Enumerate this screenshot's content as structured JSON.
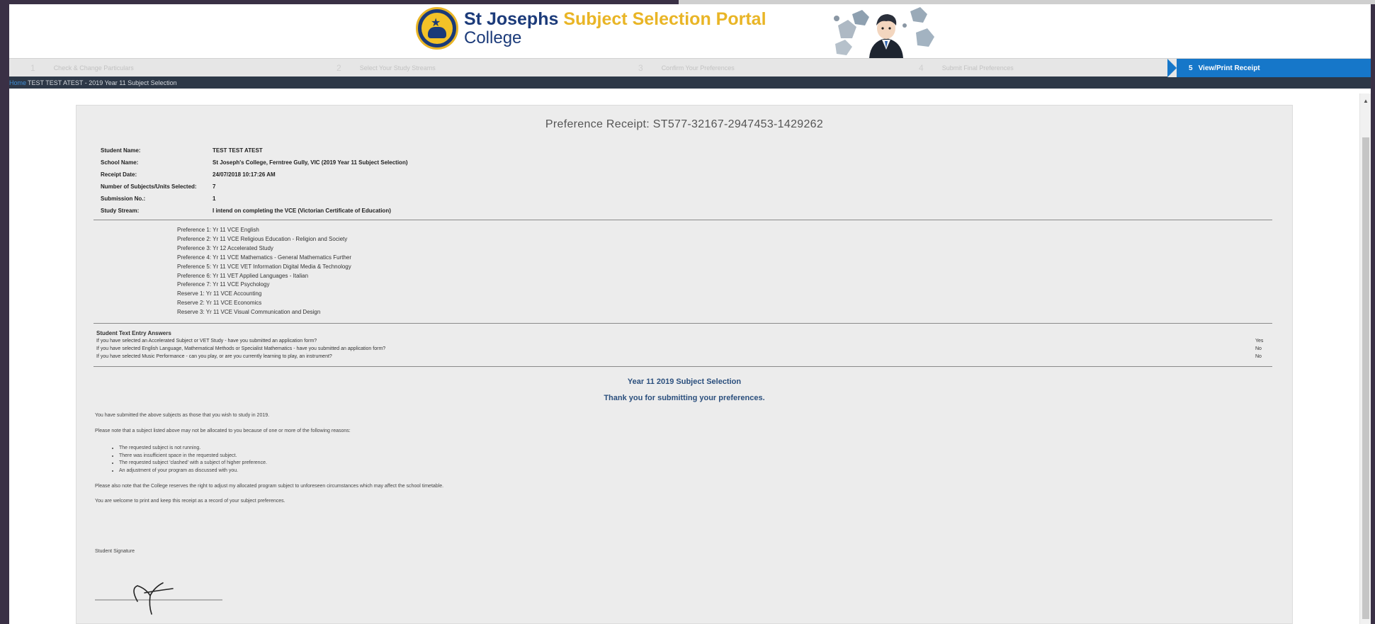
{
  "header": {
    "brand_name": "St Josephs",
    "brand_portal": "Subject Selection Portal",
    "brand_sub": "College"
  },
  "steps": [
    {
      "num": "1",
      "label": "Check & Change Particulars"
    },
    {
      "num": "2",
      "label": "Select Your Study Streams"
    },
    {
      "num": "3",
      "label": "Confirm Your Preferences"
    },
    {
      "num": "4",
      "label": "Submit Final Preferences"
    }
  ],
  "active_step": {
    "num": "5",
    "label": "View/Print Receipt"
  },
  "breadcrumb": {
    "home": "Home",
    "path": "TEST TEST ATEST - 2019 Year 11 Subject Selection"
  },
  "receipt": {
    "title": "Preference Receipt: ST577-32167-2947453-1429262",
    "info": [
      {
        "label": "Student Name:",
        "value": "TEST TEST ATEST"
      },
      {
        "label": "School Name:",
        "value": "St Joseph's College, Ferntree Gully, VIC (2019 Year 11 Subject Selection)"
      },
      {
        "label": "Receipt Date:",
        "value": "24/07/2018 10:17:26 AM"
      },
      {
        "label": "Number of Subjects/Units Selected:",
        "value": "7"
      },
      {
        "label": "Submission No.:",
        "value": "1"
      },
      {
        "label": "Study Stream:",
        "value": "I intend on completing the VCE (Victorian Certificate of Education)"
      }
    ],
    "preferences": [
      "Preference 1: Yr 11 VCE English",
      "Preference 2: Yr 11 VCE Religious Education - Religion and Society",
      "Preference 3: Yr 12 Accelerated Study",
      "Preference 4: Yr 11 VCE Mathematics - General Mathematics Further",
      "Preference 5: Yr 11 VCE VET Information Digital Media & Technology",
      "Preference 6: Yr 11 VET Applied Languages - Italian",
      "Preference 7: Yr 11 VCE Psychology",
      "Reserve 1: Yr 11 VCE Accounting",
      "Reserve 2: Yr 11 VCE Economics",
      "Reserve 3: Yr 11 VCE Visual Communication and Design"
    ],
    "text_entry": {
      "title": "Student Text Entry Answers",
      "rows": [
        {
          "q": "If you have selected an Accelerated Subject or VET Study - have you submitted an application form?",
          "a": "Yes"
        },
        {
          "q": "If you have selected English Language, Mathematical Methods or Specialist Mathematics - have you submitted an application form?",
          "a": "No"
        },
        {
          "q": "If you have selected Music Performance - can you play, or are you currently learning to play, an instrument?",
          "a": "No"
        }
      ]
    },
    "selection_title": "Year 11 2019 Subject Selection",
    "thank_you": "Thank you for submitting your preferences.",
    "msg_submitted": "You have submitted the above subjects as those that you wish to study in 2019.",
    "msg_note": "Please note that a subject listed above may not be allocated to you because of one or more of the following reasons:",
    "reasons": [
      "The requested subject is not running.",
      "There was insufficient space in the requested subject.",
      "The requested subject 'clashed' with a subject of higher preference.",
      "An adjustment of your program as discussed with you."
    ],
    "msg_adjust": "Please also note that the College reserves the right to adjust my allocated program subject to unforeseen circumstances which may affect the school timetable.",
    "msg_print": "You are welcome to print and keep this receipt as a record of your subject preferences.",
    "signature_label": "Student Signature"
  }
}
